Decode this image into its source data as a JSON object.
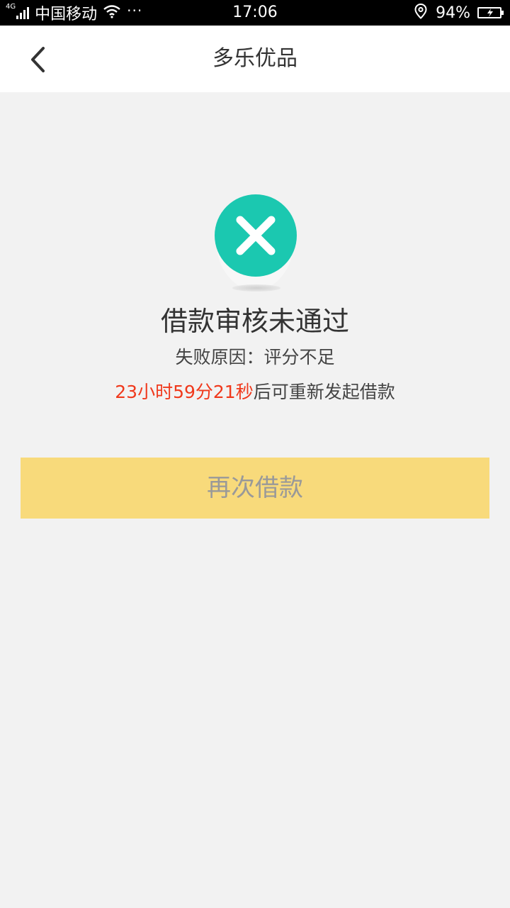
{
  "status_bar": {
    "network": "4G",
    "carrier": "中国移动",
    "more": "···",
    "time": "17:06",
    "battery_percent": "94%",
    "battery_level": 0.94,
    "battery_color": "#3dd46b",
    "icons": [
      "signal-icon",
      "wifi-icon",
      "location-icon",
      "battery-icon"
    ]
  },
  "nav": {
    "title": "多乐优品",
    "back_icon": "chevron-left-icon"
  },
  "result": {
    "icon": "close-circle-icon",
    "icon_color": "#1bc8b0",
    "title": "借款审核未通过",
    "reason": "失败原因：评分不足",
    "countdown": "23小时59分21秒",
    "countdown_suffix": "后可重新发起借款",
    "countdown_color": "#f0391c"
  },
  "actions": {
    "retry_label": "再次借款",
    "retry_color": "#f8da7b"
  }
}
